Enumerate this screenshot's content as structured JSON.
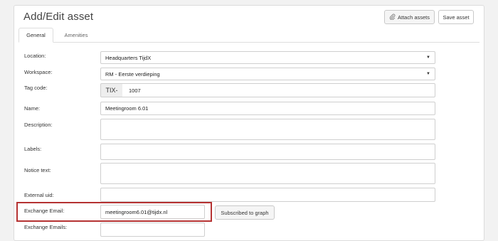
{
  "page": {
    "title": "Add/Edit asset",
    "buttons": {
      "attach": "Attach assets",
      "save": "Save asset"
    },
    "icons": {
      "attach": "paperclip-icon",
      "dropdown": "caret-down-icon"
    }
  },
  "tabs": [
    {
      "label": "General",
      "active": true
    },
    {
      "label": "Amenities",
      "active": false
    }
  ],
  "form": {
    "location": {
      "label": "Location:",
      "value": "Headquarters TijdX"
    },
    "workspace": {
      "label": "Workspace:",
      "value": "RM - Eerste verdieping"
    },
    "tag_code": {
      "label": "Tag code:",
      "prefix": "TIX-",
      "value": "1007"
    },
    "name": {
      "label": "Name:",
      "value": "Meetingroom 6.01"
    },
    "description": {
      "label": "Description:",
      "value": ""
    },
    "labels": {
      "label": "Labels:",
      "value": ""
    },
    "notice_text": {
      "label": "Notice text:",
      "value": ""
    },
    "external_uid": {
      "label": "External uid:",
      "value": ""
    },
    "exchange_email": {
      "label": "Exchange Email:",
      "value": "meetingroom6.01@tijdx.nl",
      "status_button": "Subscribed to graph"
    },
    "exchange_emails": {
      "label": "Exchange Emails:",
      "value": ""
    }
  },
  "colors": {
    "highlight_border": "#b53232"
  }
}
